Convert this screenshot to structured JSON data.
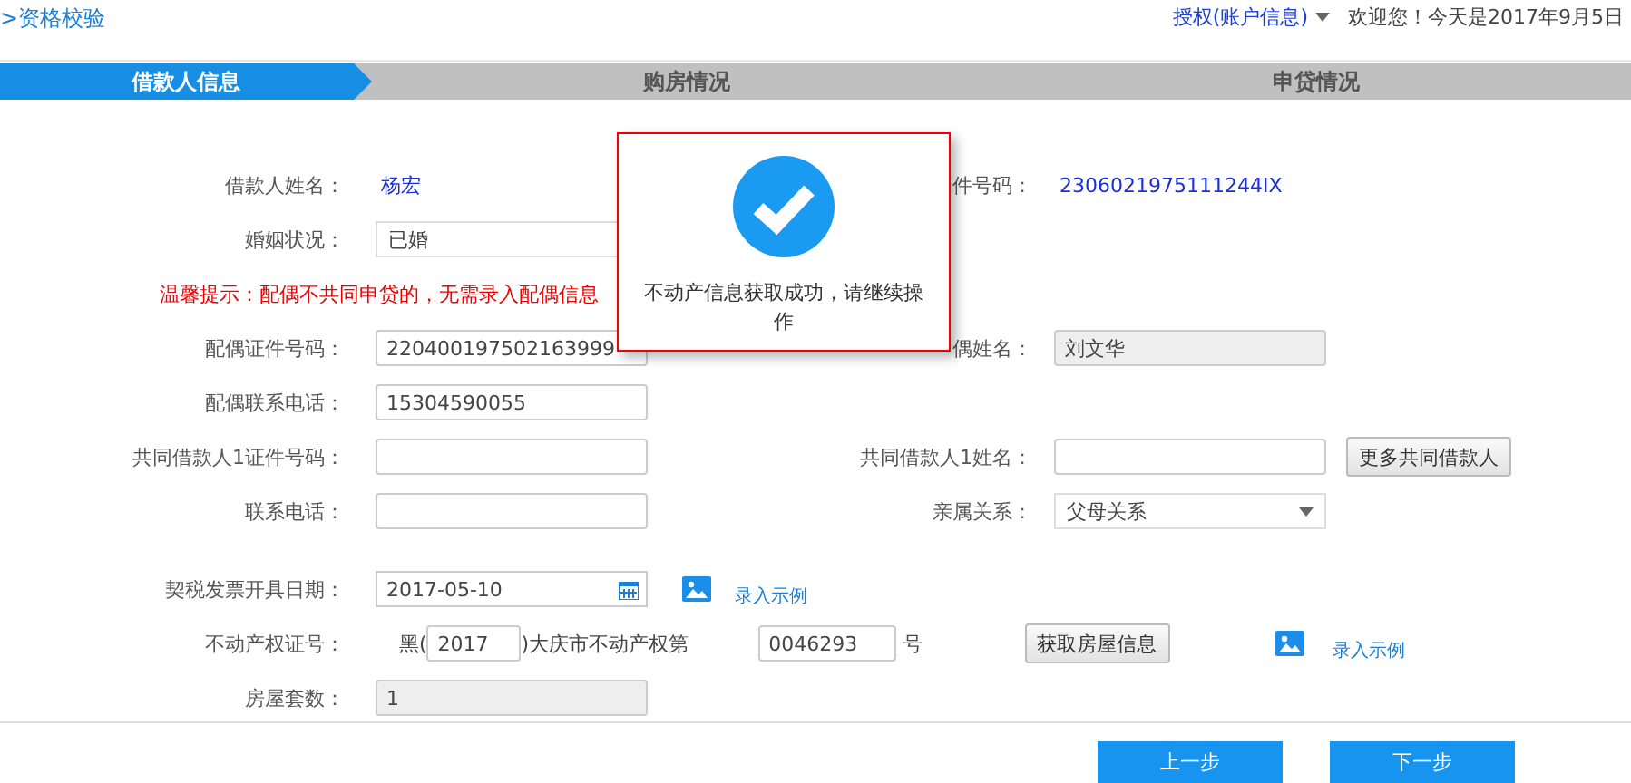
{
  "header": {
    "breadcrumb": ">资格校验",
    "account_menu": "授权(账户信息)",
    "welcome": "欢迎您！今天是2017年9月5日"
  },
  "steps": [
    {
      "label": "借款人信息",
      "selected": true
    },
    {
      "label": "购房情况",
      "selected": false
    },
    {
      "label": "申贷情况",
      "selected": false
    }
  ],
  "rows": [
    {
      "kind": "fields",
      "fields": [
        {
          "label": "借款人姓名：",
          "kind": "text",
          "value": "杨宏"
        },
        {
          "label": "件号码：",
          "kind": "text",
          "value": "2306021975111244IX"
        }
      ]
    },
    {
      "kind": "fields",
      "fields": [
        {
          "label": "婚姻状况：",
          "kind": "select",
          "value": "已婚"
        }
      ]
    },
    {
      "kind": "notice",
      "text": "温馨提示：配偶不共同申贷的，无需录入配偶信息"
    },
    {
      "kind": "fields",
      "fields": [
        {
          "label": "配偶证件号码：",
          "kind": "input",
          "value": "220400197502163999",
          "disabled": false
        },
        {
          "label": "偶姓名：",
          "kind": "input",
          "value": "刘文华",
          "disabled": true
        }
      ]
    },
    {
      "kind": "fields",
      "fields": [
        {
          "label": "配偶联系电话：",
          "kind": "input",
          "value": "15304590055",
          "disabled": false
        }
      ]
    },
    {
      "kind": "fields",
      "fields": [
        {
          "label": "共同借款人1证件号码：",
          "kind": "input",
          "disabled": false
        },
        {
          "label": "共同借款人1姓名：",
          "kind": "input",
          "disabled": false
        }
      ],
      "button": "更多共同借款人"
    },
    {
      "kind": "fields",
      "fields": [
        {
          "label": "联系电话：",
          "kind": "input",
          "disabled": false
        },
        {
          "label": "亲属关系：",
          "kind": "select",
          "value": "父母关系"
        }
      ]
    },
    {
      "kind": "date",
      "label": "契税发票开具日期：",
      "value": "2017-05-10",
      "link": "录入示例"
    },
    {
      "kind": "certificate",
      "label": "不动产权证号：",
      "prefix": "黑(",
      "year": "2017",
      "middle": ")大庆市不动产权第",
      "number": "0046293",
      "suffix": "号",
      "button": "获取房屋信息",
      "link": "录入示例"
    },
    {
      "kind": "fields",
      "fields": [
        {
          "label": "房屋套数：",
          "kind": "input",
          "value": "1",
          "disabled": true
        }
      ]
    }
  ],
  "footer": {
    "buttons": [
      "上一步",
      "下一步"
    ]
  },
  "modal": {
    "message": "不动产信息获取成功，请继续操作"
  }
}
